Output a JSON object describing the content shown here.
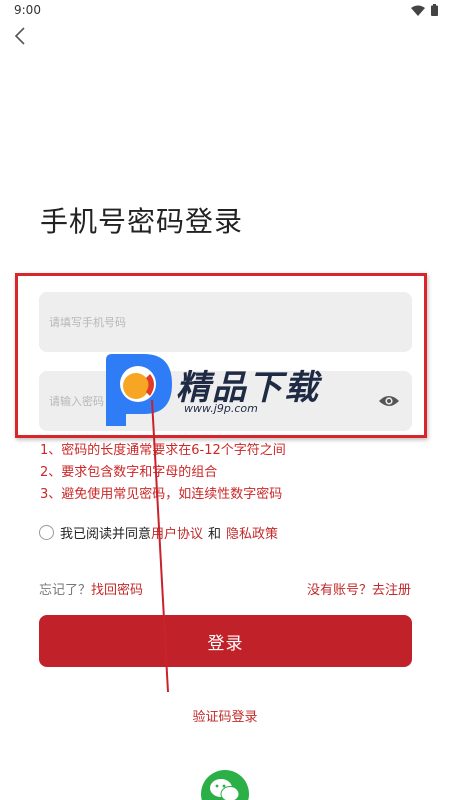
{
  "status_bar": {
    "time": "9:00",
    "icons": [
      "wifi-icon",
      "battery-icon"
    ]
  },
  "header": {
    "back_icon": "chevron-left-icon"
  },
  "page_title": "手机号密码登录",
  "form": {
    "phone_placeholder": "请填写手机号码",
    "phone_value": "",
    "password_placeholder": "请输入密码",
    "password_value": "",
    "eye_icon": "eye-icon"
  },
  "password_rules": [
    "1、密码的长度通常要求在6-12个字符之间",
    "2、要求包含数字和字母的组合",
    "3、避免使用常见密码，如连续性数字密码"
  ],
  "agreement": {
    "prefix": "我已阅读并同意",
    "user_agreement": "用户协议",
    "and": "和",
    "privacy_policy": "隐私政策",
    "checked": false
  },
  "forgot": {
    "prefix": "忘记了？",
    "link": "找回密码"
  },
  "register": {
    "label": "没有账号？去注册"
  },
  "login_button": "登录",
  "sms_login": "验证码登录",
  "wechat_icon": "wechat-icon",
  "watermark": {
    "brand": "精品下载",
    "url": "www.j9p.com"
  },
  "colors": {
    "accent": "#c1222a",
    "link": "#c22a2a",
    "rule_text": "#cc2727",
    "input_bg": "#eeeeee",
    "highlight_border": "#d9262a",
    "wechat": "#2ab046"
  }
}
